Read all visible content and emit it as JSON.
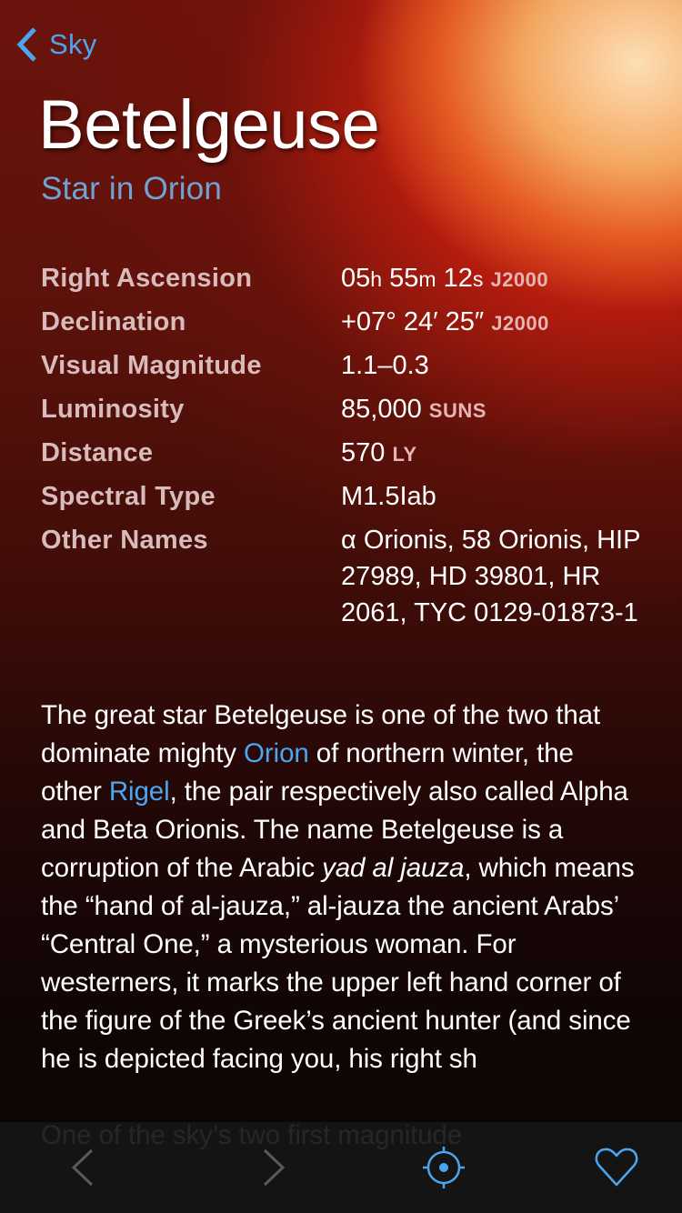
{
  "nav": {
    "back_label": "Sky",
    "back_icon": "chevron-left-icon"
  },
  "header": {
    "title": "Betelgeuse",
    "subtitle": "Star in Orion"
  },
  "facts": [
    {
      "label": "Right Ascension",
      "value_parts": [
        "05",
        "h",
        " 55",
        "m",
        " 12",
        "s"
      ],
      "unit": "J2000"
    },
    {
      "label": "Declination",
      "value": "+07° 24′ 25″",
      "unit": "J2000"
    },
    {
      "label": "Visual Magnitude",
      "value": "1.1–0.3",
      "unit": ""
    },
    {
      "label": "Luminosity",
      "value": "85,000",
      "unit": "SUNS"
    },
    {
      "label": "Distance",
      "value": "570",
      "unit": "LY"
    },
    {
      "label": "Spectral Type",
      "value": "M1.5Iab",
      "unit": ""
    },
    {
      "label": "Other Names",
      "value": "α Orionis, 58 Orionis, HIP 27989, HD 39801, HR 2061, TYC 0129-01873-1",
      "unit": ""
    }
  ],
  "description": {
    "p1": {
      "s1": "The great star Betelgeuse is one of the two that dominate mighty ",
      "link1": "Orion",
      "s2": " of northern winter, the other ",
      "link2": "Rigel",
      "s3": ", the pair respectively also called Alpha and Beta Orionis. The name Betelgeuse is a corruption of the Arabic ",
      "italic": "yad al jauza",
      "s4": ", which means the “hand of al-jauza,” al-jauza the ancient Arabs’ “Central One,” a mysterious woman. For westerners, it marks the upper left hand corner of the figure of the Greek’s ancient hunter (and since he is depicted facing you, his right sh"
    },
    "p2": "One of the sky’s two first magnitude"
  },
  "toolbar": {
    "prev_icon": "chevron-left-icon",
    "next_icon": "chevron-right-icon",
    "locate_icon": "crosshair-target-icon",
    "favorite_icon": "heart-icon"
  },
  "colors": {
    "accent": "#4aa6f0",
    "subtitle": "#6ea3d3",
    "label": "#d8bcbc",
    "unit": "#e8b5b5",
    "toolbar_bg": "#161616",
    "toolbar_disabled": "#5a5a5a"
  }
}
